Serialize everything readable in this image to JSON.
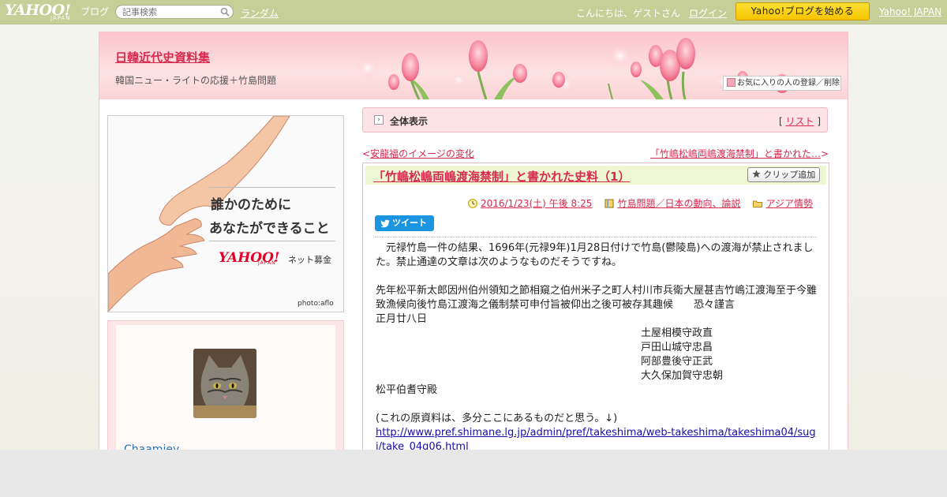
{
  "topbar": {
    "logo_yahoo": "YAHOO!",
    "logo_japan": "JAPAN",
    "logo_blog": "ブログ",
    "search_placeholder": "記事検索",
    "random_label": "ランダム",
    "greeting": "こんにちは、ゲストさん",
    "login_label": "ログイン",
    "start_label": "Yahoo!ブログを始める",
    "yahoo_japan_label": "Yahoo! JAPAN",
    "bg_color": "#c6cf97"
  },
  "header": {
    "blog_title": "日韓近代史資料集",
    "blog_subtitle": "韓国ニュー・ライトの応援＋竹島問題",
    "fav_label": "お気に入りの人の登録／削除"
  },
  "ad": {
    "line1": "誰かのために",
    "line2": "あなたができること",
    "brand_yahoo": "YAHOO!",
    "brand_japan": "JAPAN",
    "brand_service": "ネット募金",
    "photo_credit": "photo:aflo"
  },
  "profile": {
    "name": "Chaamiey"
  },
  "section": {
    "title": "全体表示",
    "list_open": "[ ",
    "list_label": "リスト",
    "list_close": " ]"
  },
  "nav": {
    "prev_arrow": "<",
    "prev_label": "安龍福のイメージの変化",
    "next_label": "「竹嶋松嶋両嶋渡海禁制」と書かれた…",
    "next_arrow": ">"
  },
  "article": {
    "title": "「竹嶋松嶋両嶋渡海禁制」と書かれた史料（1）",
    "clip_label": "クリップ追加",
    "date": "2016/1/23(土) 午後 8:25",
    "category": "竹島問題／日本の動向、論説",
    "folder": "アジア情勢",
    "tweet_label": "ツイート",
    "paragraph1": "　元禄竹島一件の結果、1696年(元禄9年)1月28日付けで竹島(鬱陵島)への渡海が禁止されました。禁止通達の文章は次のようなものだそうですね。",
    "paragraph2": "先年松平新太郎因州伯州領知之節相窺之伯州米子之町人村川市兵衛大屋甚吉竹嶋江渡海至于今雖致漁候向後竹島江渡海之儀制禁可申付旨被仰出之後可被存其趣候　　恐々謹言",
    "date_line": "正月廿八日",
    "signatories": [
      "土屋相模守政直",
      "戸田山城守忠昌",
      "阿部豊後守正武",
      "大久保加賀守忠朝"
    ],
    "addressee": "松平伯耆守殿",
    "note": "(これの原資料は、多分ここにあるものだと思う。↓)",
    "source_url": "http://www.pref.shimane.lg.jp/admin/pref/takeshima/web-takeshima/takeshima04/sugi/take_04g06.html"
  },
  "colors": {
    "accent": "#d62a4f",
    "link_blue": "#1a0dab",
    "tweet_blue": "#1b95e0",
    "start_yellow": "#f5c400"
  }
}
